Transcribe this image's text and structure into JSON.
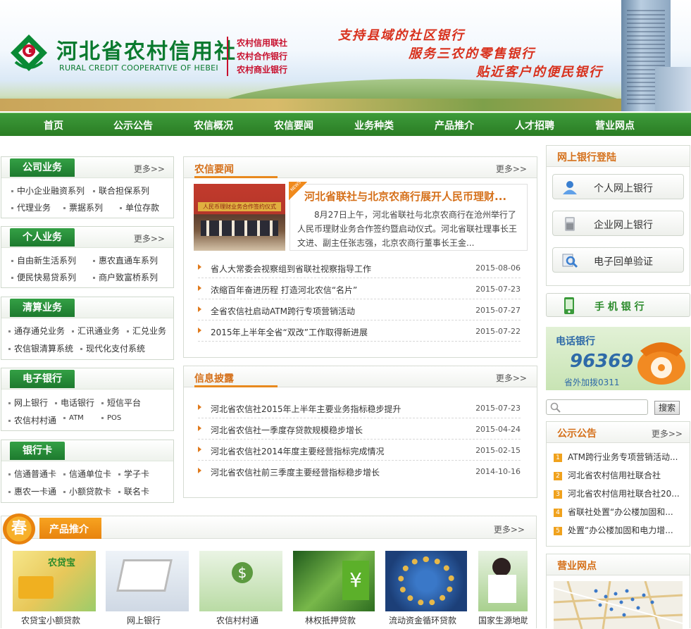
{
  "header": {
    "cn_name": "河北省农村信用社",
    "en_name": "RURAL CREDIT COOPERATIVE OF HEBEI",
    "aliases": [
      "农村信用联社",
      "农村合作银行",
      "农村商业银行"
    ],
    "slogans": [
      "支持县域的社区银行",
      "服务三农的零售银行",
      "贴近客户的便民银行"
    ]
  },
  "nav": [
    "首页",
    "公示公告",
    "农信概况",
    "农信要闻",
    "业务种类",
    "产品推介",
    "人才招聘",
    "营业网点"
  ],
  "more_label": "更多>>",
  "left": {
    "company": {
      "title": "公司业务",
      "items": [
        "中小企业融资系列",
        "联合担保系列",
        "代理业务",
        "票据系列",
        "单位存款"
      ]
    },
    "personal": {
      "title": "个人业务",
      "items": [
        "自由新生活系列",
        "惠农直通车系列",
        "便民快易贷系列",
        "商户致富桥系列"
      ]
    },
    "clearing": {
      "title": "清算业务",
      "items": [
        "通存通兑业务",
        "汇讯通业务",
        "汇兑业务",
        "农信银清算系统",
        "现代化支付系统"
      ]
    },
    "ebank": {
      "title": "电子银行",
      "items": [
        "网上银行",
        "电话银行",
        "短信平台",
        "农信村村通",
        "ATM",
        "POS"
      ]
    },
    "card": {
      "title": "银行卡",
      "items": [
        "信通普通卡",
        "信通单位卡",
        "学子卡",
        "惠农一卡通",
        "小额贷款卡",
        "联名卡"
      ]
    }
  },
  "news": {
    "title": "农信要闻",
    "featured_badge": "NEWS",
    "featured_photo_caption": "人民币理财业务合作签约仪式",
    "featured_title": "河北省联社与北京农商行展开人民币理财...",
    "featured_summary": "8月27日上午，河北省联社与北京农商行在沧州举行了人民币理财业务合作签约暨启动仪式。河北省联社理事长王文进、副主任张志强，北京农商行董事长王金...",
    "items": [
      {
        "title": "省人大常委会视察组到省联社视察指导工作",
        "date": "2015-08-06"
      },
      {
        "title": "浓缩百年奋进历程 打造河北农信“名片”",
        "date": "2015-07-23"
      },
      {
        "title": "全省农信社启动ATM跨行专项营销活动",
        "date": "2015-07-27"
      },
      {
        "title": "2015年上半年全省“双改”工作取得新进展",
        "date": "2015-07-22"
      }
    ]
  },
  "disclosure": {
    "title": "信息披露",
    "items": [
      {
        "title": "河北省农信社2015年上半年主要业务指标稳步提升",
        "date": "2015-07-23"
      },
      {
        "title": "河北省农信社一季度存贷款规模稳步增长",
        "date": "2015-04-24"
      },
      {
        "title": "河北省农信社2014年度主要经营指标完成情况",
        "date": "2015-02-15"
      },
      {
        "title": "河北省农信社前三季度主要经营指标稳步增长",
        "date": "2014-10-16"
      }
    ]
  },
  "right": {
    "login_title": "网上银行登陆",
    "personal_bank": "个人网上银行",
    "corp_bank": "企业网上银行",
    "receipt": "电子回单验证",
    "mobile_bank": "手 机 银 行",
    "phone_bank_title": "电话银行",
    "phone_number": "96369",
    "phone_ext": "省外加拨0311",
    "search_placeholder": "",
    "search_button": "搜索",
    "notice_title": "公示公告",
    "notices": [
      {
        "num": "1",
        "text": "ATM跨行业务专项营销活动..."
      },
      {
        "num": "2",
        "text": "河北省农村信用社联合社"
      },
      {
        "num": "3",
        "text": "河北省农村信用社联合社20..."
      },
      {
        "num": "4",
        "text": "省联社处置“办公楼加固和..."
      },
      {
        "num": "5",
        "text": "处置“办公楼加固和电力增..."
      }
    ],
    "branch_title": "营业网点"
  },
  "products": {
    "badge": "春",
    "title": "产品推介",
    "tile_text": "农贷宝",
    "items": [
      "农贷宝小额贷款",
      "网上银行",
      "农信村村通",
      "林权抵押贷款",
      "流动资金循环贷款",
      "国家生源地助"
    ]
  },
  "colors": {
    "brand_green": "#2a7d24",
    "accent_orange": "#d5701a",
    "slogan_red": "#d8301c"
  }
}
